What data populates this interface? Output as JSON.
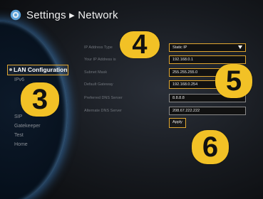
{
  "header": {
    "title": "Settings ▸ Network",
    "icon": "gear-icon"
  },
  "menu": {
    "items": [
      {
        "label": "LAN Configuration",
        "selected": true
      },
      {
        "label": "IPv6",
        "selected": false
      },
      {
        "label": "",
        "selected": false
      },
      {
        "label": "",
        "selected": false
      },
      {
        "label": "",
        "selected": false
      },
      {
        "label": "SIP",
        "selected": false
      },
      {
        "label": "Gatekeeper",
        "selected": false
      },
      {
        "label": "Test",
        "selected": false
      },
      {
        "label": "Home",
        "selected": false
      }
    ]
  },
  "form": {
    "ip_type_label": "IP Address Type",
    "ip_type_value": "Static IP",
    "ip_address_label": "Your IP Address is",
    "ip_address_value": "192.168.0.1",
    "subnet_label": "Subnet Mask",
    "subnet_value": "255.255.255.0",
    "gateway_label": "Default Gateway",
    "gateway_value": "192.168.0.254",
    "dns1_label": "Preferred DNS Server",
    "dns1_value": "8.8.8.8",
    "dns2_label": "Alternate DNS Server",
    "dns2_value": "208.67.222.222",
    "apply_label": "Apply"
  },
  "badges": {
    "b3": "3",
    "b4": "4",
    "b5": "5",
    "b6": "6"
  },
  "colors": {
    "accent": "#e0a630",
    "badge": "#f2c126",
    "glow": "#4696e6"
  }
}
